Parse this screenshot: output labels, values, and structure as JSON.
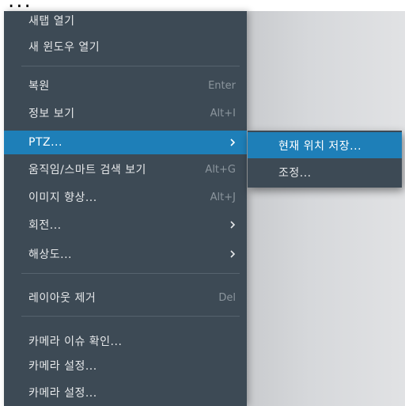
{
  "top_fragment": "...",
  "menu": {
    "items": [
      {
        "label": "새탭 열기",
        "shortcut": ""
      },
      {
        "label": "새 윈도우 열기",
        "shortcut": ""
      },
      {
        "label": "복원",
        "shortcut": "Enter"
      },
      {
        "label": "정보 보기",
        "shortcut": "Alt+I"
      },
      {
        "label": "PTZ...",
        "shortcut": "",
        "submenu": true,
        "selected": true
      },
      {
        "label": "움직임/스마트 검색 보기",
        "shortcut": "Alt+G"
      },
      {
        "label": "이미지 향상...",
        "shortcut": "Alt+J"
      },
      {
        "label": "회전...",
        "shortcut": "",
        "submenu": true
      },
      {
        "label": "해상도...",
        "shortcut": "",
        "submenu": true
      },
      {
        "label": "레이아웃 제거",
        "shortcut": "Del"
      },
      {
        "label": "카메라 이슈 확인...",
        "shortcut": ""
      },
      {
        "label": "카메라 설정...",
        "shortcut": ""
      },
      {
        "label": "카메라 설정...",
        "shortcut": ""
      }
    ]
  },
  "submenu": {
    "items": [
      {
        "label": "현재 위치 저장...",
        "selected": true
      },
      {
        "label": "조정..."
      }
    ]
  },
  "colors": {
    "menu_bg": "#3d4a55",
    "selected_bg": "#1e7fb8",
    "text": "#e6e8ea",
    "shortcut_text": "#8b959d",
    "separator": "#56636e"
  }
}
